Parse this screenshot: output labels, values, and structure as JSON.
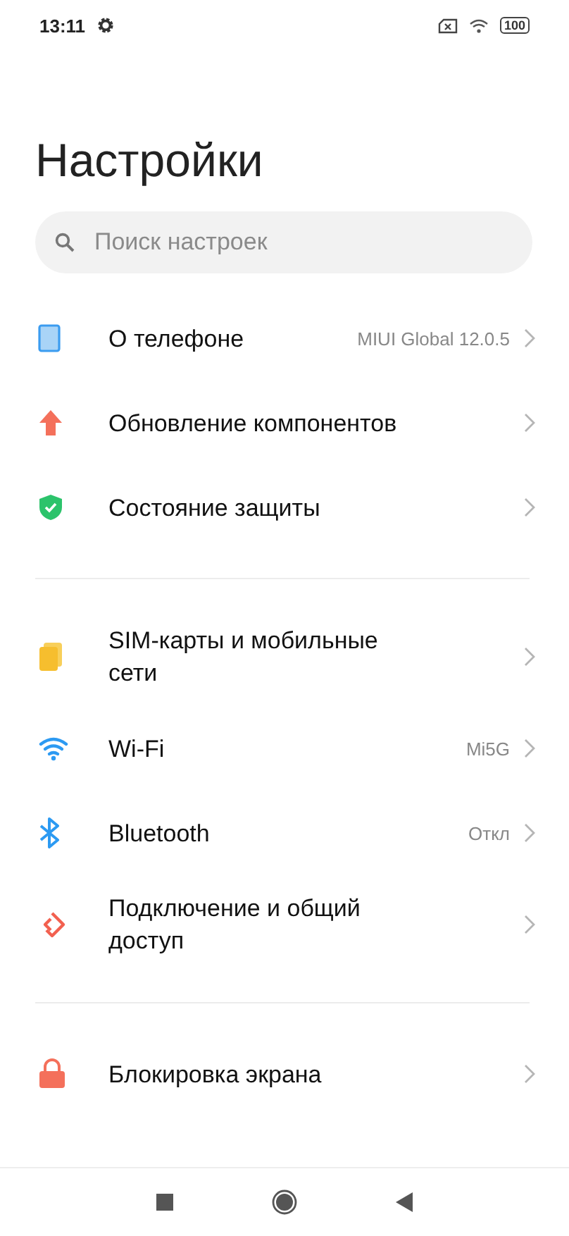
{
  "status_bar": {
    "time": "13:11",
    "battery": "100"
  },
  "title": "Настройки",
  "search": {
    "placeholder": "Поиск настроек"
  },
  "groups": [
    {
      "items": [
        {
          "kind": "phone",
          "label": "О телефоне",
          "value": "MIUI Global 12.0.5"
        },
        {
          "kind": "update",
          "label": "Обновление компонентов"
        },
        {
          "kind": "shield",
          "label": "Состояние защиты"
        }
      ]
    },
    {
      "items": [
        {
          "kind": "sim",
          "label": "SIM-карты и мобильные сети"
        },
        {
          "kind": "wifi",
          "label": "Wi-Fi",
          "value": "Mi5G"
        },
        {
          "kind": "bluetooth",
          "label": "Bluetooth",
          "value": "Откл"
        },
        {
          "kind": "share",
          "label": "Подключение и общий доступ"
        }
      ]
    },
    {
      "items": [
        {
          "kind": "lock",
          "label": "Блокировка экрана"
        }
      ]
    }
  ]
}
